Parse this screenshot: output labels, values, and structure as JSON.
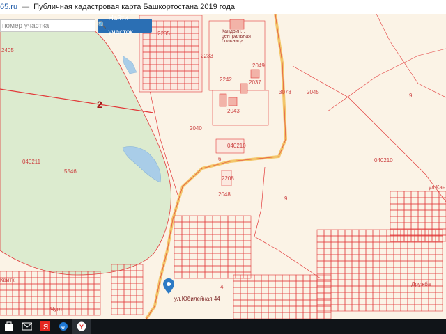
{
  "window": {
    "site": "65.ru",
    "title": "Публичная кадастровая карта Башкортостана 2019 года"
  },
  "search": {
    "placeholder": "номер участка",
    "button_label": "Найти участок"
  },
  "map": {
    "zone_label": "2",
    "labels": {
      "q040211": "040211",
      "q040210_center": "040210",
      "q040210_right": "040210",
      "n5546": "5546",
      "n2040": "2040",
      "n2048": "2048",
      "n9": "9",
      "n2045": "2045",
      "n2405": "2405",
      "n2205": "2205",
      "n2233": "2233",
      "n2242": "2242",
      "n2037": "2037",
      "n3078": "3078",
      "n2208": "2208",
      "n2043": "2043",
      "n2049": "2049",
      "n6": "6",
      "n4": "4",
      "hospital": "Кандрин... центральная больница",
      "street": "ул.Юбилейная 44",
      "kvit": "Квитк",
      "druzhba": "Дружба",
      "chugi": "Чугл",
      "kand": "ул.Кан"
    },
    "colors": {
      "background": "#fbf3e6",
      "forest": "#dcebcf",
      "parcel_line": "#e23a3a",
      "water": "#a9cde8",
      "road": "#f3c66a",
      "marker": "#2d7ac4"
    }
  },
  "taskbar": {
    "icons": [
      "store-icon",
      "mail-icon",
      "yandex-icon",
      "edge-icon",
      "yandex-browser-icon"
    ]
  }
}
